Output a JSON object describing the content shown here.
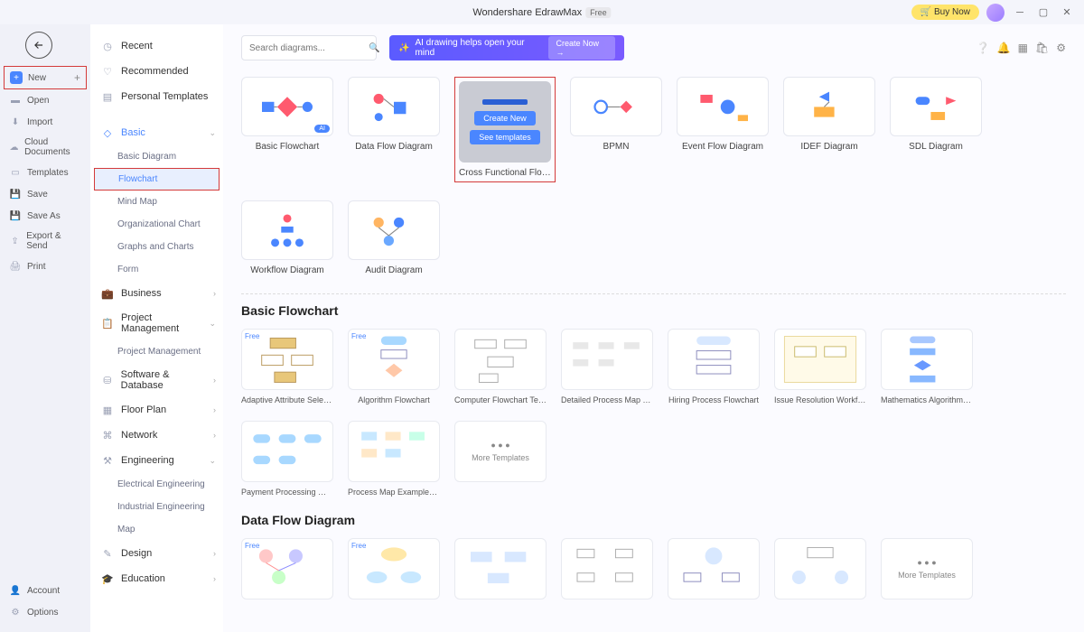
{
  "titlebar": {
    "app": "Wondershare EdrawMax",
    "free": "Free",
    "buy_now": "Buy Now"
  },
  "sidebar1": {
    "new": "New",
    "open": "Open",
    "import": "Import",
    "cloud": "Cloud Documents",
    "templates": "Templates",
    "save": "Save",
    "saveas": "Save As",
    "export": "Export & Send",
    "print": "Print",
    "account": "Account",
    "options": "Options"
  },
  "sidebar2": {
    "recent": "Recent",
    "recommended": "Recommended",
    "personal": "Personal Templates",
    "basic": "Basic",
    "basic_items": [
      "Basic Diagram",
      "Flowchart",
      "Mind Map",
      "Organizational Chart",
      "Graphs and Charts",
      "Form"
    ],
    "business": "Business",
    "pm": "Project Management",
    "pm_sub": "Project Management",
    "sd": "Software & Database",
    "fp": "Floor Plan",
    "net": "Network",
    "eng": "Engineering",
    "eng_items": [
      "Electrical Engineering",
      "Industrial Engineering",
      "Map"
    ],
    "design": "Design",
    "edu": "Education"
  },
  "search": {
    "placeholder": "Search diagrams..."
  },
  "ai_banner": {
    "text": "AI drawing helps open your mind",
    "cta": "Create Now →"
  },
  "types": {
    "row1": [
      "Basic Flowchart",
      "Data Flow Diagram",
      "Cross Functional Flow...",
      "BPMN",
      "Event Flow Diagram",
      "IDEF Diagram",
      "SDL Diagram"
    ],
    "row2": [
      "Workflow Diagram",
      "Audit Diagram"
    ],
    "highlight_btns": {
      "create": "Create New",
      "see": "See templates"
    }
  },
  "sections": {
    "basic_flowchart": {
      "title": "Basic Flowchart",
      "templates": [
        "Adaptive Attribute Selectio...",
        "Algorithm Flowchart",
        "Computer Flowchart Temp...",
        "Detailed Process Map Tem...",
        "Hiring Process Flowchart",
        "Issue Resolution Workflow ...",
        "Mathematics Algorithm Fl...",
        "Payment Processing Workf...",
        "Process Map Examples Te..."
      ],
      "more": "More Templates"
    },
    "dfd": {
      "title": "Data Flow Diagram",
      "templates": [
        "",
        "",
        "",
        "",
        "",
        "",
        ""
      ],
      "more": "More Templates"
    }
  }
}
